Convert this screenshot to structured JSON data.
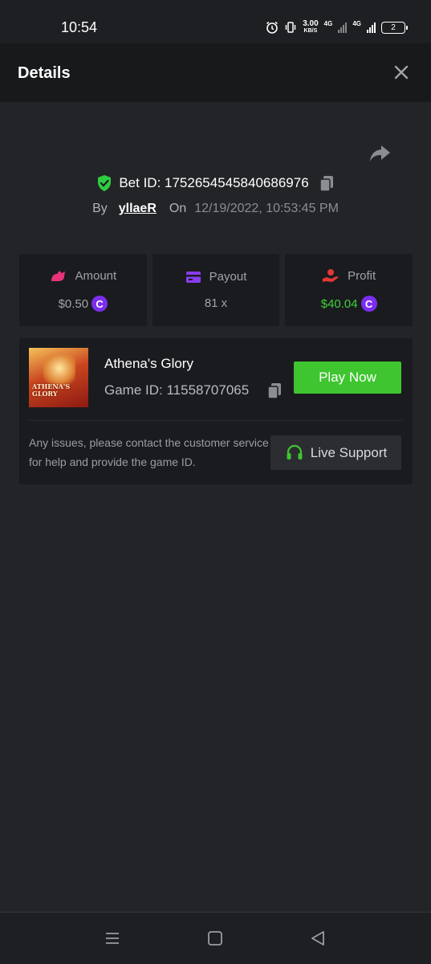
{
  "status_bar": {
    "time": "10:54",
    "speed_value": "3.00",
    "speed_unit": "KB/S",
    "network_1": "4G",
    "network_2": "4G",
    "battery": "2",
    "icons": [
      "alarm-icon",
      "vibrate-icon",
      "signal-icon",
      "battery-icon"
    ]
  },
  "header": {
    "title": "Details",
    "close_icon": "close-icon"
  },
  "bet": {
    "label": "Bet ID: 1752654545840686976",
    "by_label": "By",
    "username": "yllaeR",
    "on_label": "On",
    "datetime": "12/19/2022, 10:53:45 PM",
    "verified_icon": "shield-check-icon",
    "copy_icon": "copy-icon",
    "share_icon": "share-icon"
  },
  "stats": [
    {
      "label": "Amount",
      "value": "$0.50",
      "icon": "amount-icon",
      "icon_color": "#e8327a",
      "has_coin": true,
      "value_color": "#a0a3a8"
    },
    {
      "label": "Payout",
      "value": "81 x",
      "icon": "card-icon",
      "icon_color": "#8a3cf0",
      "has_coin": false,
      "value_color": "#a0a3a8"
    },
    {
      "label": "Profit",
      "value": "$40.04",
      "icon": "profit-icon",
      "icon_color": "#e53935",
      "has_coin": true,
      "value_color": "#3fd13a"
    }
  ],
  "game": {
    "name": "Athena's Glory",
    "game_id": "Game ID: 11558707065",
    "thumb_text": "ATHENA'S GLORY",
    "play_label": "Play Now",
    "support_text": "Any issues, please contact the customer service for help and provide the game ID.",
    "support_label": "Live Support",
    "support_icon": "headset-icon"
  },
  "colors": {
    "background": "#232427",
    "card": "#1a1b1e",
    "accent_green": "#3ec52f",
    "coin": "#7b2ef0"
  }
}
